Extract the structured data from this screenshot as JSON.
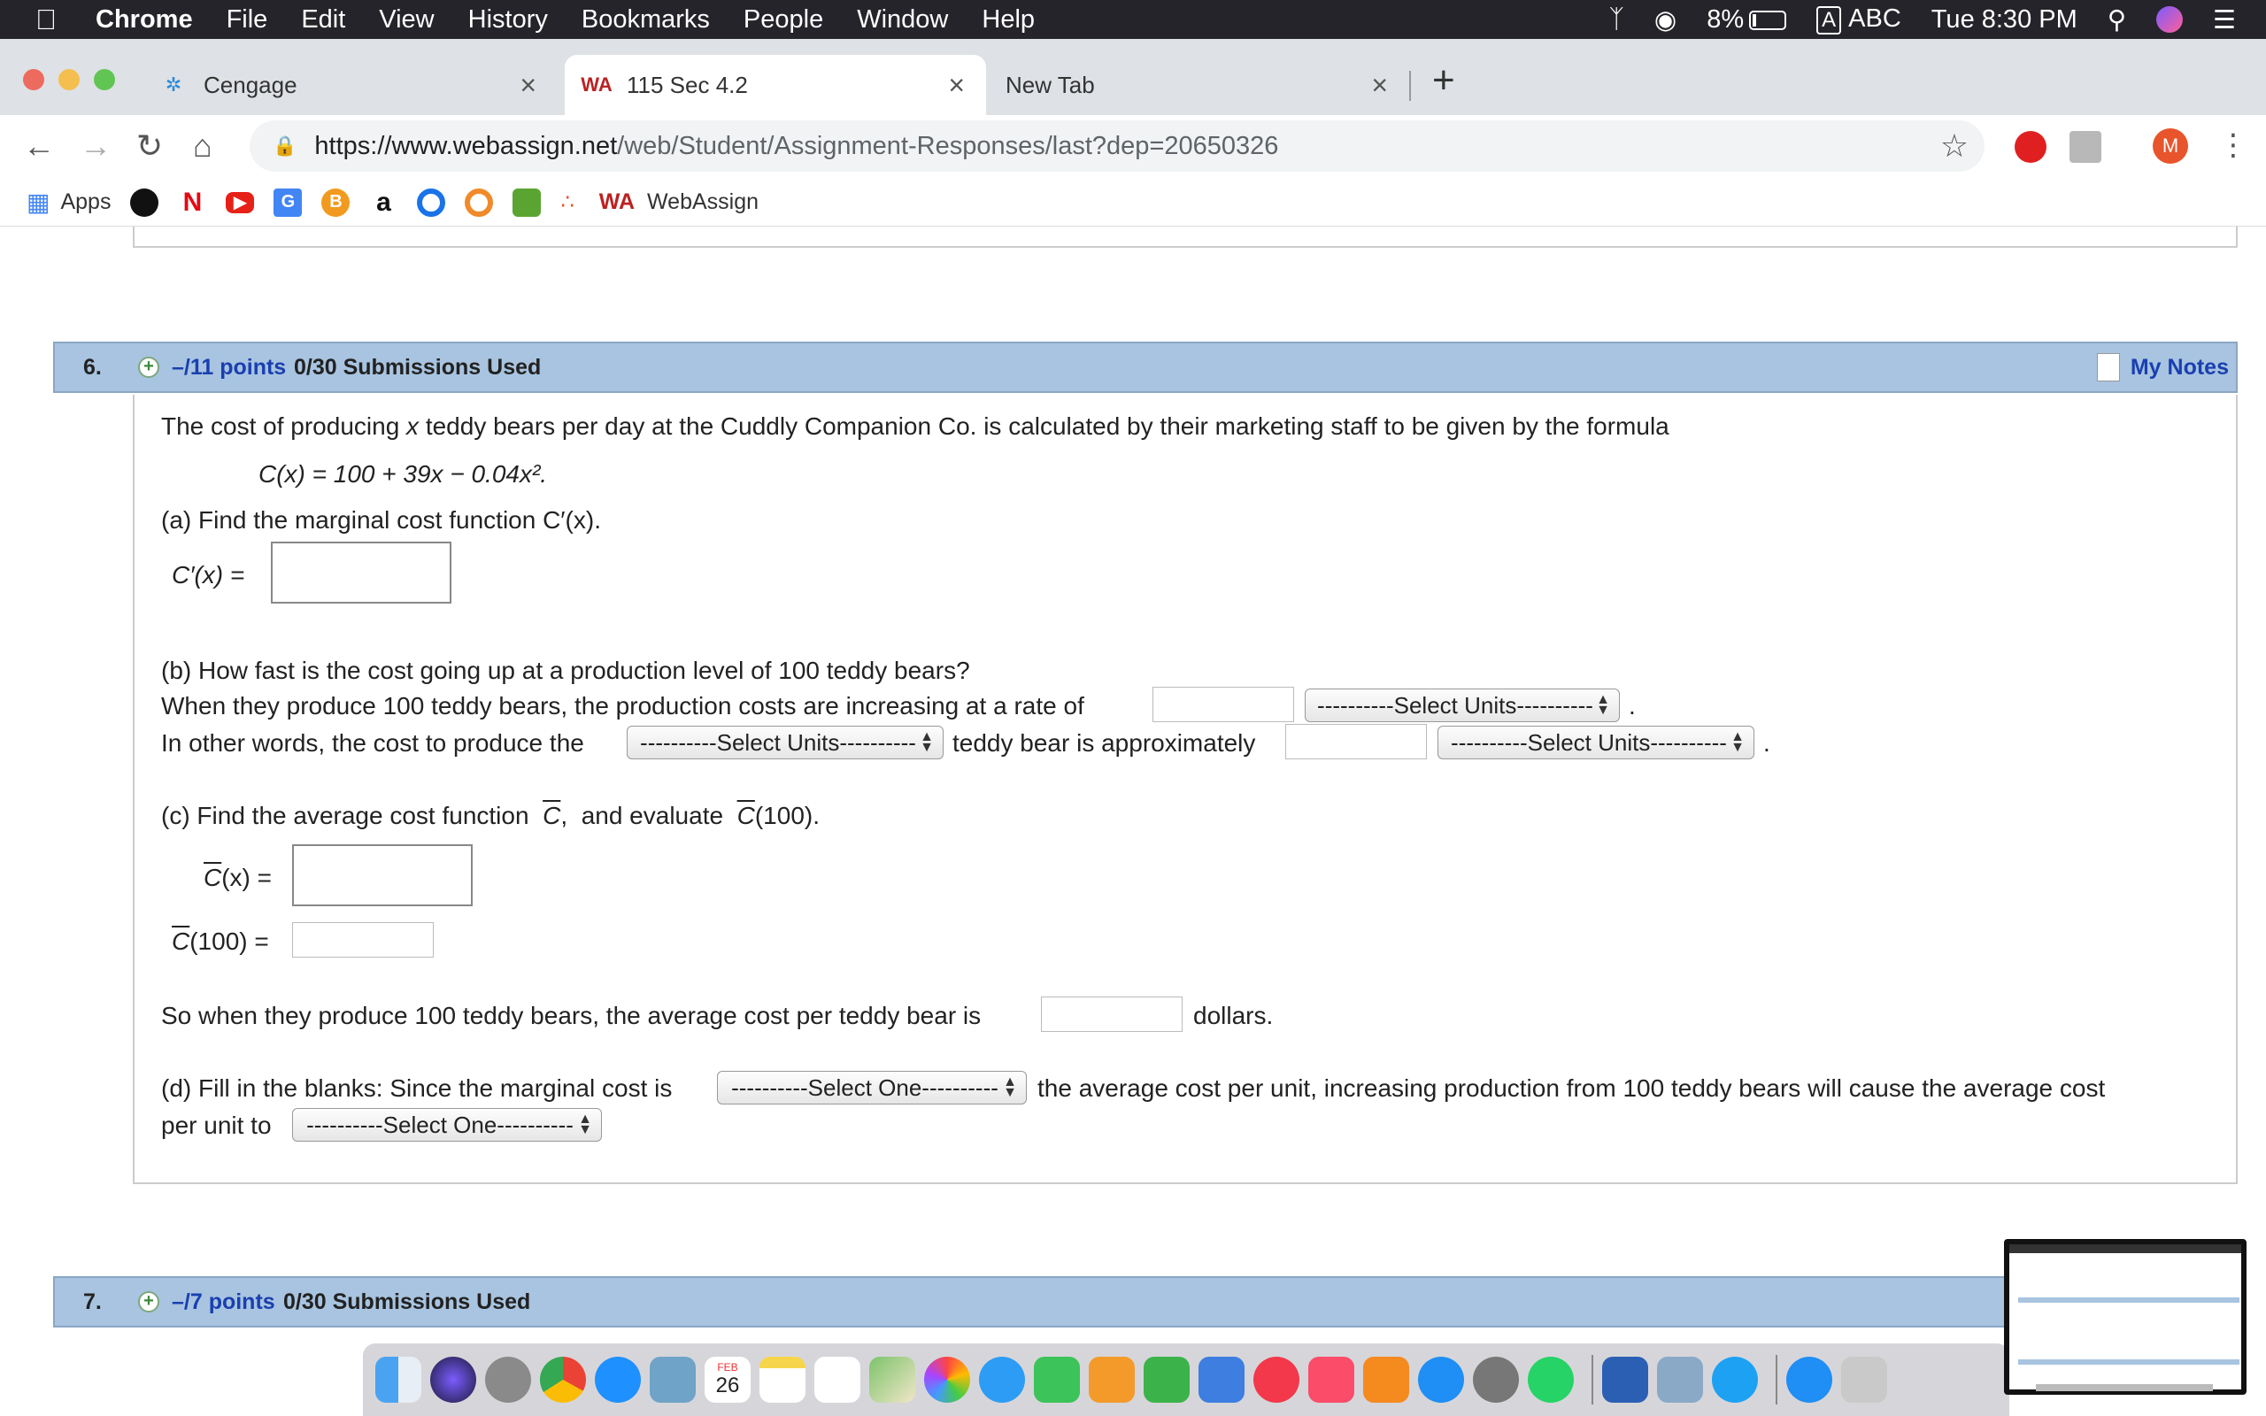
{
  "menubar": {
    "app": "Chrome",
    "items": [
      "File",
      "Edit",
      "View",
      "History",
      "Bookmarks",
      "People",
      "Window",
      "Help"
    ],
    "battery": "8%",
    "input_source_box": "A",
    "input_source": "ABC",
    "clock": "Tue 8:30 PM"
  },
  "tabs": [
    {
      "title": "Cengage",
      "active": false
    },
    {
      "title": "115 Sec 4.2",
      "active": true
    },
    {
      "title": "New Tab",
      "active": false
    }
  ],
  "new_tab_label": "+",
  "omnibox": {
    "host": "https://www.webassign.net",
    "path": "/web/Student/Assignment-Responses/last?dep=20650326"
  },
  "profile_initial": "M",
  "bookmarks": {
    "apps_label": "Apps",
    "webassign_label": "WebAssign"
  },
  "question6": {
    "number": "6.",
    "points": "–/11 points",
    "submissions": "0/30 Submissions Used",
    "notes": "My Notes",
    "intro_a": "The cost of producing ",
    "intro_x": "x",
    "intro_b": " teddy bears per day at the Cuddly Companion Co. is calculated by their marketing staff to be given by the formula",
    "formula": "C(x) = 100 + 39x − 0.04x².",
    "part_a": "(a) Find the marginal cost function C′(x).",
    "part_a_label": "C′(x)  =",
    "part_b_question": "(b) How fast is the cost going up at a production level of 100 teddy bears?",
    "part_b_line1": "When they produce 100 teddy bears, the production costs are increasing at a rate of",
    "part_b_line2_a": "In other words, the cost to produce the",
    "part_b_line2_b": "teddy bear is approximately",
    "select_units": "----------Select Units----------",
    "period": ".",
    "part_c_a": "(c) Find the average cost function",
    "part_c_cbar": "C",
    "part_c_comma": ",",
    "part_c_b": "and evaluate",
    "part_c_eval": "(100).",
    "cbar_x_label": "(x) =",
    "cbar_100_label": "(100) =",
    "avg_cost_a": "So when they produce 100 teddy bears, the average cost per teddy bear is",
    "avg_cost_b": "dollars.",
    "part_d_a": "(d) Fill in the blanks: Since the marginal cost is",
    "part_d_b": "the average cost per unit, increasing production from 100 teddy bears will cause the average cost",
    "part_d_c": "per unit to",
    "select_one": "----------Select One----------"
  },
  "question7": {
    "number": "7.",
    "points": "–/7 points",
    "submissions": "0/30 Submissions Used"
  },
  "dock": {
    "calendar_month": "FEB",
    "calendar_day": "26"
  }
}
